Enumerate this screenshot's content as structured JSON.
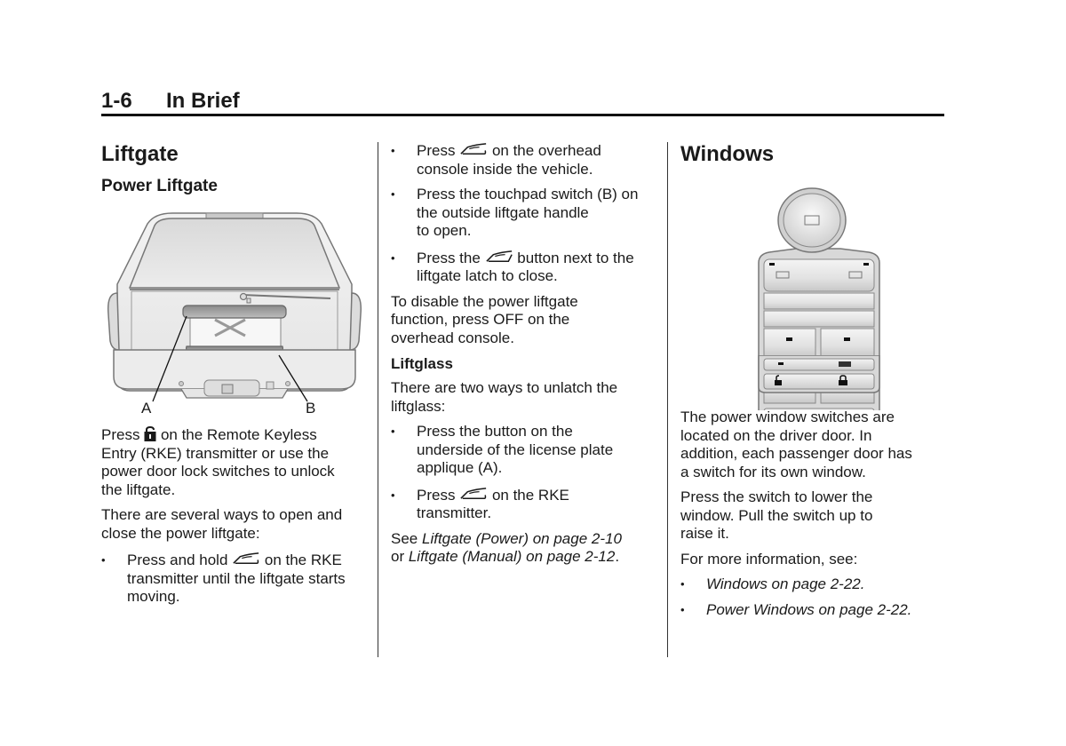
{
  "header": {
    "page_number": "1-6",
    "section_title": "In Brief"
  },
  "col1": {
    "title": "Liftgate",
    "subtitle": "Power Liftgate",
    "figure": {
      "label_a": "A",
      "label_b": "B"
    },
    "para1": {
      "before_icon": "Press",
      "icon": "unlock-icon",
      "line1_after": "on the Remote Keyless",
      "line2": "Entry (RKE) transmitter or use the",
      "line3": "power door lock switches to unlock",
      "line4": "the liftgate."
    },
    "para2": {
      "line1": "There are several ways to open and",
      "line2": "close the power liftgate:"
    },
    "bullet1": {
      "before_icon": "Press and hold",
      "icon": "liftgate-icon",
      "line1_after": "on the RKE",
      "line2": "transmitter until the liftgate starts",
      "line3": "moving."
    }
  },
  "col2": {
    "bullet1": {
      "before_icon": "Press",
      "icon": "liftgate-icon",
      "line1_after": "on the overhead",
      "line2": "console inside the vehicle."
    },
    "bullet2": {
      "line1": "Press the touchpad switch (B) on",
      "line2": "the outside liftgate handle",
      "line3": "to open."
    },
    "bullet3": {
      "before_icon": "Press the",
      "icon": "liftgate-close-icon",
      "line1_after": "button next to the",
      "line2": "liftgate latch to close."
    },
    "para1": {
      "line1": "To disable the power liftgate",
      "line2": "function, press OFF on the",
      "line3": "overhead console."
    },
    "subheading": "Liftglass",
    "para2": {
      "line1": "There are two ways to unlatch the",
      "line2": "liftglass:"
    },
    "bullet4": {
      "line1": "Press the button on the",
      "line2": "underside of the license plate",
      "line3": "applique (A)."
    },
    "bullet5": {
      "before_icon": "Press",
      "icon": "liftgate-icon",
      "line1_after": "on the RKE",
      "line2": "transmitter."
    },
    "see": {
      "prefix": "See ",
      "ref1": "Liftgate (Power) on page 2-10",
      "mid": "or ",
      "ref2": "Liftgate (Manual) on page 2-12",
      "suffix": "."
    }
  },
  "col3": {
    "title": "Windows",
    "para1": {
      "line1": "The power window switches are",
      "line2": "located on the driver door. In",
      "line3": "addition, each passenger door has",
      "line4": "a switch for its own window."
    },
    "para2": {
      "line1": "Press the switch to lower the",
      "line2": "window. Pull the switch up to",
      "line3": "raise it."
    },
    "para3": "For more information, see:",
    "refs": [
      "Windows on page 2-22.",
      "Power Windows on page 2-22."
    ]
  },
  "bullet_glyph": "•"
}
